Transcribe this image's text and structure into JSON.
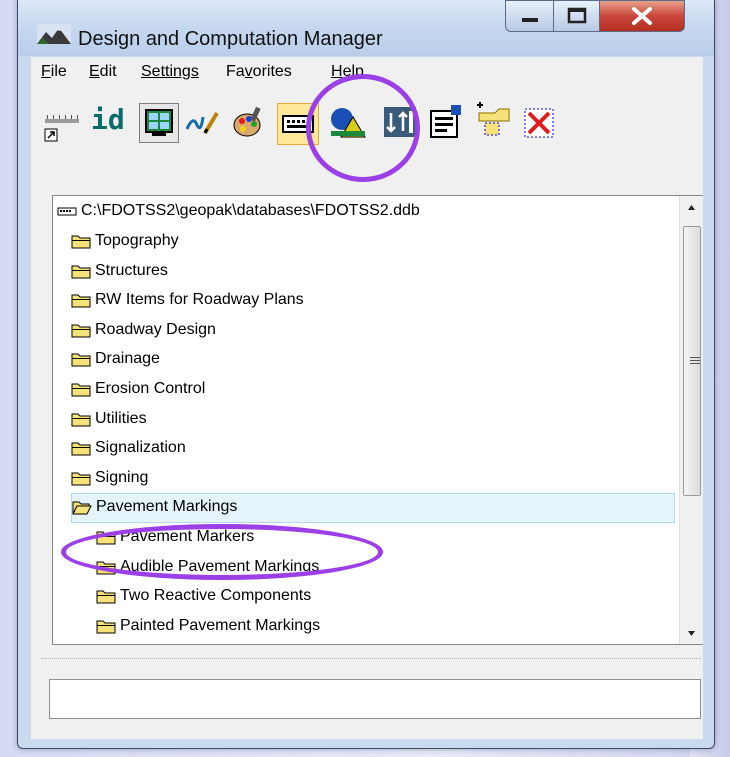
{
  "window": {
    "title": "Design and Computation Manager",
    "controls": {
      "minimize": "minimize-icon",
      "maximize": "maximize-icon",
      "close": "close-icon"
    }
  },
  "menu": [
    {
      "label": "File",
      "ul": "F"
    },
    {
      "label": "Edit",
      "ul": "E"
    },
    {
      "label": "Settings",
      "ul": "S"
    },
    {
      "label": "Favorites",
      "ul": "v"
    },
    {
      "label": "Help",
      "ul": "H"
    }
  ],
  "toolbar": {
    "id_label": "id",
    "buttons": [
      "place-icon",
      "id-icon",
      "display-icon",
      "draw-icon",
      "palette-icon",
      "keyboard-icon",
      "shape-icon",
      "tool-icon",
      "properties-icon",
      "add-item-icon",
      "delete-icon"
    ],
    "selected": "keyboard-icon"
  },
  "tree": {
    "root": "C:\\FDOTSS2\\geopak\\databases\\FDOTSS2.ddb",
    "items": [
      {
        "label": "Topography",
        "level": 1,
        "open": false
      },
      {
        "label": "Structures",
        "level": 1,
        "open": false
      },
      {
        "label": "RW Items for Roadway Plans",
        "level": 1,
        "open": false
      },
      {
        "label": "Roadway Design",
        "level": 1,
        "open": false
      },
      {
        "label": "Drainage",
        "level": 1,
        "open": false
      },
      {
        "label": "Erosion Control",
        "level": 1,
        "open": false
      },
      {
        "label": "Utilities",
        "level": 1,
        "open": false
      },
      {
        "label": "Signalization",
        "level": 1,
        "open": false
      },
      {
        "label": "Signing",
        "level": 1,
        "open": false
      },
      {
        "label": "Pavement Markings",
        "level": 1,
        "open": true,
        "selected": true
      },
      {
        "label": "Pavement Markers",
        "level": 2,
        "open": false
      },
      {
        "label": "Audible Pavement Markings",
        "level": 2,
        "open": false
      },
      {
        "label": "Two Reactive Components",
        "level": 2,
        "open": false
      },
      {
        "label": "Painted Pavement Markings",
        "level": 2,
        "open": false
      }
    ]
  },
  "colors": {
    "highlight": "#9b3fe6",
    "folder": "#f7e27a",
    "selection": "#e5f3fb"
  },
  "status": {
    "value": ""
  }
}
